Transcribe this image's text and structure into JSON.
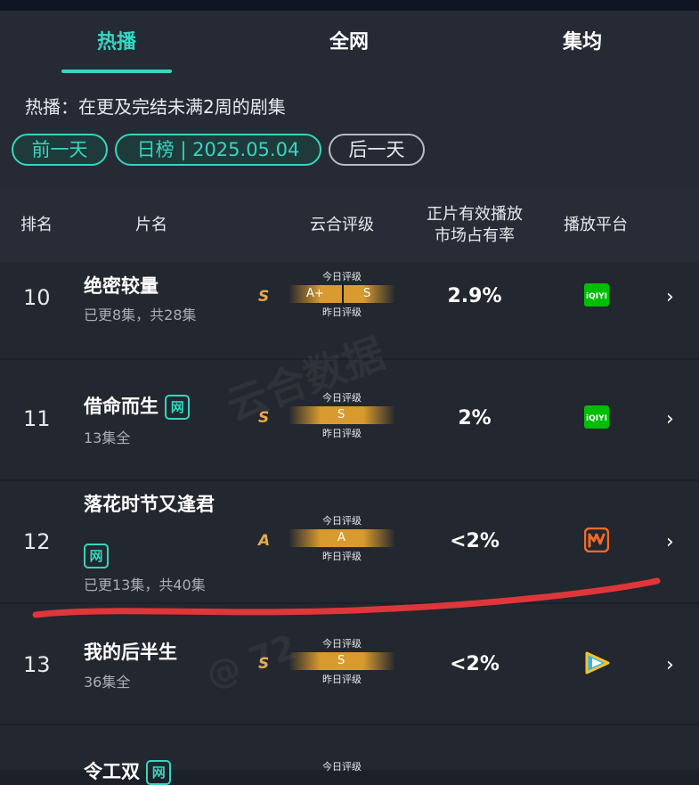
{
  "tabs": [
    {
      "label": "热播",
      "active": true
    },
    {
      "label": "全网",
      "active": false
    },
    {
      "label": "集均",
      "active": false
    }
  ],
  "description": "热播：在更及完结未满2周的剧集",
  "date_controls": {
    "prev": "前一天",
    "current": "日榜 | 2025.05.04",
    "next": "后一天"
  },
  "columns": {
    "rank": "排名",
    "title": "片名",
    "rating": "云合评级",
    "share_line1": "正片有效播放",
    "share_line2": "市场占有率",
    "platform": "播放平台"
  },
  "gauge_labels": {
    "today": "今日评级",
    "yesterday": "昨日评级"
  },
  "badge_label": "网",
  "watermark": {
    "line1": "云合数据",
    "line2": "@ 72"
  },
  "rows": [
    {
      "rank": "10",
      "title": "绝密较量",
      "subtitle": "已更8集，共28集",
      "grade": "S",
      "gauge_left": "A+",
      "gauge_right": "S",
      "share": "2.9%",
      "platform": "iqiyi"
    },
    {
      "rank": "11",
      "title": "借命而生",
      "subtitle": "13集全",
      "grade": "S",
      "gauge_center": "S",
      "share": "2%",
      "platform": "iqiyi"
    },
    {
      "rank": "12",
      "title": "落花时节又逢君",
      "subtitle": "已更13集，共40集",
      "grade": "A",
      "gauge_center": "A",
      "share": "<2%",
      "platform": "mango"
    },
    {
      "rank": "13",
      "title": "我的后半生",
      "subtitle": "36集全",
      "grade": "S",
      "gauge_center": "S",
      "share": "<2%",
      "platform": "tencent"
    },
    {
      "rank": "",
      "title": "令工双"
    }
  ],
  "colors": {
    "accent": "#35d6c0",
    "grade": "#e6a94a",
    "gauge": "#d99a2e",
    "annotation_line": "#e0363a",
    "iqiyi": "#00be06",
    "mango": "#f26a24"
  }
}
